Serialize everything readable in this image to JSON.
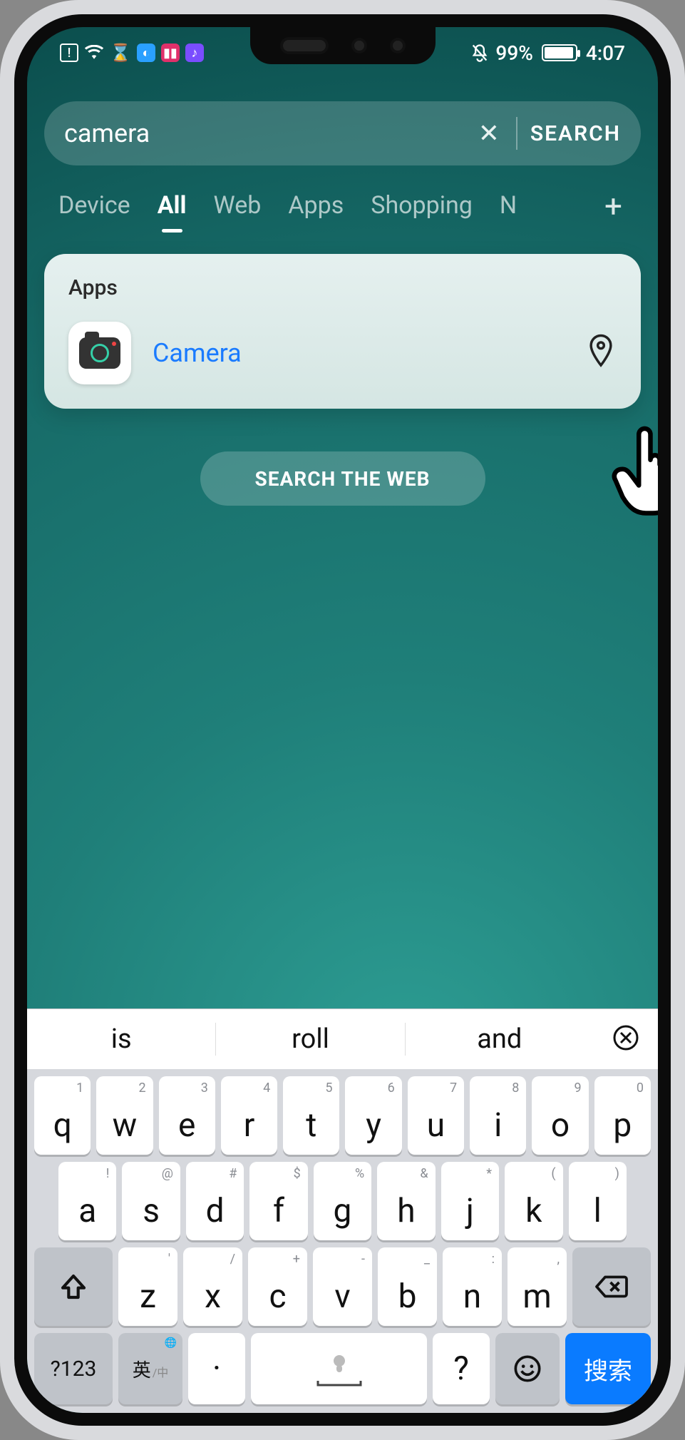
{
  "status": {
    "battery_percent": "99%",
    "time": "4:07"
  },
  "search": {
    "query": "camera",
    "clear_glyph": "✕",
    "button_label": "SEARCH"
  },
  "tabs": {
    "items": [
      "Device",
      "All",
      "Web",
      "Apps",
      "Shopping"
    ],
    "truncated_next_initial": "N",
    "active_index": 1,
    "add_glyph": "+"
  },
  "results": {
    "section_title": "Apps",
    "app_name": "Camera"
  },
  "web_button_label": "SEARCH THE WEB",
  "suggestions": [
    "is",
    "roll",
    "and"
  ],
  "keyboard": {
    "row1": [
      {
        "hint": "1",
        "main": "q"
      },
      {
        "hint": "2",
        "main": "w"
      },
      {
        "hint": "3",
        "main": "e"
      },
      {
        "hint": "4",
        "main": "r"
      },
      {
        "hint": "5",
        "main": "t"
      },
      {
        "hint": "6",
        "main": "y"
      },
      {
        "hint": "7",
        "main": "u"
      },
      {
        "hint": "8",
        "main": "i"
      },
      {
        "hint": "9",
        "main": "o"
      },
      {
        "hint": "0",
        "main": "p"
      }
    ],
    "row2": [
      {
        "hint": "!",
        "main": "a"
      },
      {
        "hint": "@",
        "main": "s"
      },
      {
        "hint": "#",
        "main": "d"
      },
      {
        "hint": "$",
        "main": "f"
      },
      {
        "hint": "%",
        "main": "g"
      },
      {
        "hint": "&",
        "main": "h"
      },
      {
        "hint": "*",
        "main": "j"
      },
      {
        "hint": "(",
        "main": "k"
      },
      {
        "hint": ")",
        "main": "l"
      }
    ],
    "row3": [
      {
        "hint": "'",
        "main": "z"
      },
      {
        "hint": "/",
        "main": "x"
      },
      {
        "hint": "+",
        "main": "c"
      },
      {
        "hint": "-",
        "main": "v"
      },
      {
        "hint": "_",
        "main": "b"
      },
      {
        "hint": ":",
        "main": "n"
      },
      {
        "hint": ",",
        "main": "m"
      }
    ],
    "alt_label": "?123",
    "lang_main": "英",
    "lang_sub": "/中",
    "dot_label": "·",
    "question_label": "?",
    "action_label": "搜索"
  }
}
